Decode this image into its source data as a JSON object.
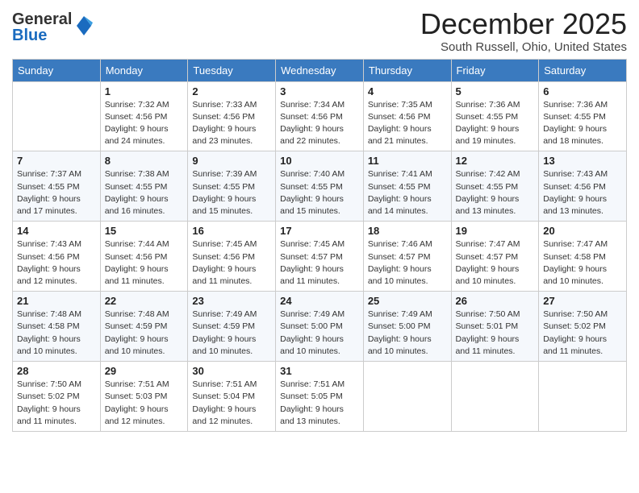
{
  "header": {
    "logo_general": "General",
    "logo_blue": "Blue",
    "month_title": "December 2025",
    "subtitle": "South Russell, Ohio, United States"
  },
  "weekdays": [
    "Sunday",
    "Monday",
    "Tuesday",
    "Wednesday",
    "Thursday",
    "Friday",
    "Saturday"
  ],
  "weeks": [
    [
      {
        "day": "",
        "info": ""
      },
      {
        "day": "1",
        "info": "Sunrise: 7:32 AM\nSunset: 4:56 PM\nDaylight: 9 hours and 24 minutes."
      },
      {
        "day": "2",
        "info": "Sunrise: 7:33 AM\nSunset: 4:56 PM\nDaylight: 9 hours and 23 minutes."
      },
      {
        "day": "3",
        "info": "Sunrise: 7:34 AM\nSunset: 4:56 PM\nDaylight: 9 hours and 22 minutes."
      },
      {
        "day": "4",
        "info": "Sunrise: 7:35 AM\nSunset: 4:56 PM\nDaylight: 9 hours and 21 minutes."
      },
      {
        "day": "5",
        "info": "Sunrise: 7:36 AM\nSunset: 4:55 PM\nDaylight: 9 hours and 19 minutes."
      },
      {
        "day": "6",
        "info": "Sunrise: 7:36 AM\nSunset: 4:55 PM\nDaylight: 9 hours and 18 minutes."
      }
    ],
    [
      {
        "day": "7",
        "info": "Sunrise: 7:37 AM\nSunset: 4:55 PM\nDaylight: 9 hours and 17 minutes."
      },
      {
        "day": "8",
        "info": "Sunrise: 7:38 AM\nSunset: 4:55 PM\nDaylight: 9 hours and 16 minutes."
      },
      {
        "day": "9",
        "info": "Sunrise: 7:39 AM\nSunset: 4:55 PM\nDaylight: 9 hours and 15 minutes."
      },
      {
        "day": "10",
        "info": "Sunrise: 7:40 AM\nSunset: 4:55 PM\nDaylight: 9 hours and 15 minutes."
      },
      {
        "day": "11",
        "info": "Sunrise: 7:41 AM\nSunset: 4:55 PM\nDaylight: 9 hours and 14 minutes."
      },
      {
        "day": "12",
        "info": "Sunrise: 7:42 AM\nSunset: 4:55 PM\nDaylight: 9 hours and 13 minutes."
      },
      {
        "day": "13",
        "info": "Sunrise: 7:43 AM\nSunset: 4:56 PM\nDaylight: 9 hours and 13 minutes."
      }
    ],
    [
      {
        "day": "14",
        "info": "Sunrise: 7:43 AM\nSunset: 4:56 PM\nDaylight: 9 hours and 12 minutes."
      },
      {
        "day": "15",
        "info": "Sunrise: 7:44 AM\nSunset: 4:56 PM\nDaylight: 9 hours and 11 minutes."
      },
      {
        "day": "16",
        "info": "Sunrise: 7:45 AM\nSunset: 4:56 PM\nDaylight: 9 hours and 11 minutes."
      },
      {
        "day": "17",
        "info": "Sunrise: 7:45 AM\nSunset: 4:57 PM\nDaylight: 9 hours and 11 minutes."
      },
      {
        "day": "18",
        "info": "Sunrise: 7:46 AM\nSunset: 4:57 PM\nDaylight: 9 hours and 10 minutes."
      },
      {
        "day": "19",
        "info": "Sunrise: 7:47 AM\nSunset: 4:57 PM\nDaylight: 9 hours and 10 minutes."
      },
      {
        "day": "20",
        "info": "Sunrise: 7:47 AM\nSunset: 4:58 PM\nDaylight: 9 hours and 10 minutes."
      }
    ],
    [
      {
        "day": "21",
        "info": "Sunrise: 7:48 AM\nSunset: 4:58 PM\nDaylight: 9 hours and 10 minutes."
      },
      {
        "day": "22",
        "info": "Sunrise: 7:48 AM\nSunset: 4:59 PM\nDaylight: 9 hours and 10 minutes."
      },
      {
        "day": "23",
        "info": "Sunrise: 7:49 AM\nSunset: 4:59 PM\nDaylight: 9 hours and 10 minutes."
      },
      {
        "day": "24",
        "info": "Sunrise: 7:49 AM\nSunset: 5:00 PM\nDaylight: 9 hours and 10 minutes."
      },
      {
        "day": "25",
        "info": "Sunrise: 7:49 AM\nSunset: 5:00 PM\nDaylight: 9 hours and 10 minutes."
      },
      {
        "day": "26",
        "info": "Sunrise: 7:50 AM\nSunset: 5:01 PM\nDaylight: 9 hours and 11 minutes."
      },
      {
        "day": "27",
        "info": "Sunrise: 7:50 AM\nSunset: 5:02 PM\nDaylight: 9 hours and 11 minutes."
      }
    ],
    [
      {
        "day": "28",
        "info": "Sunrise: 7:50 AM\nSunset: 5:02 PM\nDaylight: 9 hours and 11 minutes."
      },
      {
        "day": "29",
        "info": "Sunrise: 7:51 AM\nSunset: 5:03 PM\nDaylight: 9 hours and 12 minutes."
      },
      {
        "day": "30",
        "info": "Sunrise: 7:51 AM\nSunset: 5:04 PM\nDaylight: 9 hours and 12 minutes."
      },
      {
        "day": "31",
        "info": "Sunrise: 7:51 AM\nSunset: 5:05 PM\nDaylight: 9 hours and 13 minutes."
      },
      {
        "day": "",
        "info": ""
      },
      {
        "day": "",
        "info": ""
      },
      {
        "day": "",
        "info": ""
      }
    ]
  ]
}
